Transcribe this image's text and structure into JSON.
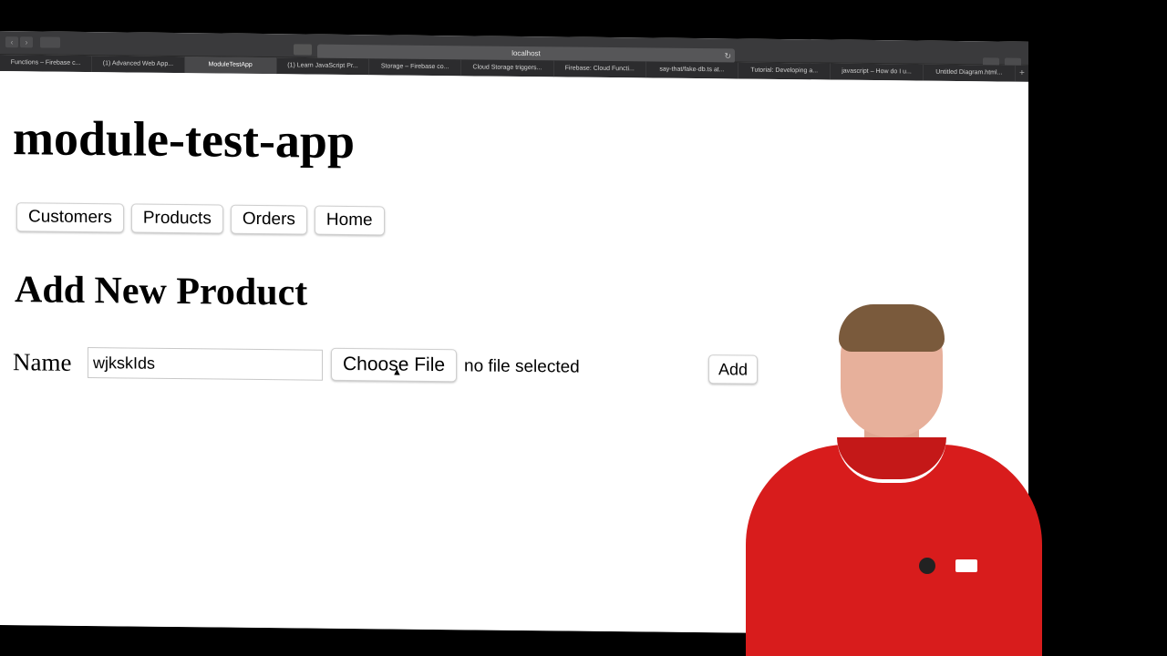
{
  "browser": {
    "url": "localhost",
    "tabs": [
      "Functions – Firebase c...",
      "(1) Advanced Web App...",
      "ModuleTestApp",
      "(1) Learn JavaScript Pr...",
      "Storage – Firebase co...",
      "Cloud Storage triggers...",
      "Firebase: Cloud Functi...",
      "say-that/fake-db.ts at...",
      "Tutorial: Developing a...",
      "javascript – How do I u...",
      "Untitled Diagram.html..."
    ],
    "active_tab_index": 2
  },
  "app": {
    "title": "module-test-app",
    "menu": [
      "Customers",
      "Products",
      "Orders",
      "Home"
    ]
  },
  "form": {
    "heading": "Add New Product",
    "name_label": "Name",
    "name_value": "wjkskIds",
    "choose_file_label": "Choose File",
    "file_status": "no file selected",
    "add_label": "Add"
  },
  "icons": {
    "back": "chevron-left-icon",
    "forward": "chevron-right-icon",
    "reload": "reload-icon",
    "new_tab": "plus-icon",
    "cursor": "mouse-pointer-icon"
  }
}
